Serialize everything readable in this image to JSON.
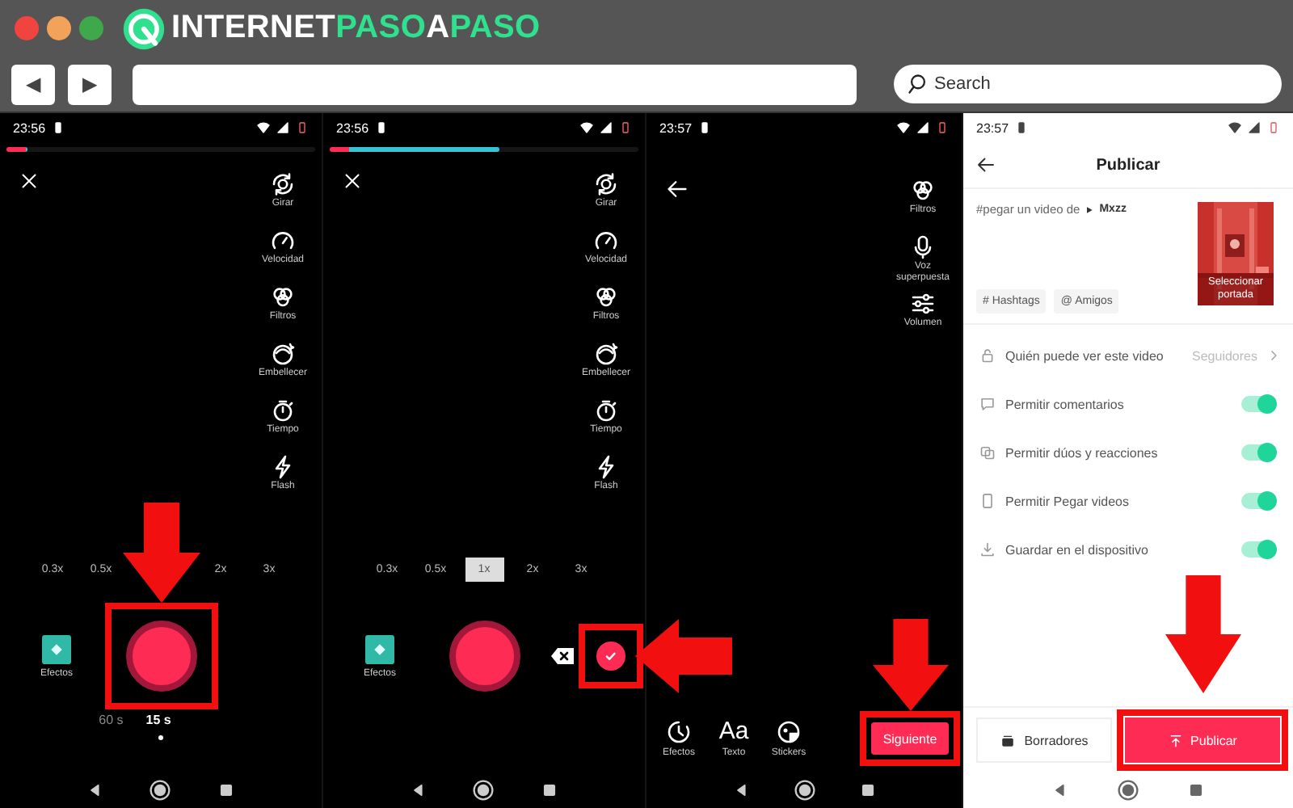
{
  "browser": {
    "window_controls": [
      {
        "color": "#f0453f"
      },
      {
        "color": "#f3a25a"
      },
      {
        "color": "#3ea84a"
      }
    ],
    "logo": [
      {
        "text": "INTERNET",
        "color": "#ffffff"
      },
      {
        "text": "PASO",
        "color": "#2fe08f"
      },
      {
        "text": "A",
        "color": "#ffffff"
      },
      {
        "text": "PASO",
        "color": "#2fe08f"
      }
    ],
    "back_button": "◀",
    "forward_button": "▶",
    "search_field": {
      "placeholder": "Search"
    }
  },
  "screens": [
    {
      "kind": "camera",
      "time": "23:56",
      "progress": {
        "level": 0.07
      },
      "tools": [
        "Girar",
        "Velocidad",
        "Filtros",
        "Embellecer",
        "Tiempo",
        "Flash"
      ],
      "zoom_options": [
        {
          "label": "0.3x",
          "selected": false
        },
        {
          "label": "0.5x",
          "selected": false
        },
        {
          "label": "2x",
          "selected": false
        },
        {
          "label": "3x",
          "selected": false
        }
      ],
      "effects_label": "Efectos",
      "record_button": {
        "highlight": {
          "kind": "down"
        }
      },
      "durations": [
        {
          "label": "60 s",
          "selected": false
        },
        {
          "label": "15 s",
          "selected": true
        }
      ]
    },
    {
      "kind": "camera",
      "time": "23:56",
      "progress": {
        "level": 0.55
      },
      "tools": [
        "Girar",
        "Velocidad",
        "Filtros",
        "Embellecer",
        "Tiempo",
        "Flash"
      ],
      "zoom_options": [
        {
          "label": "0.3x",
          "selected": false
        },
        {
          "label": "0.5x",
          "selected": false
        },
        {
          "label": "1x",
          "selected": true
        },
        {
          "label": "2x",
          "selected": false
        },
        {
          "label": "3x",
          "selected": false
        }
      ],
      "effects_label": "Efectos",
      "confirm_button": {
        "highlight": {
          "kind": "left"
        }
      }
    },
    {
      "kind": "edit",
      "time": "23:57",
      "tools": [
        "Filtros",
        "Voz superpuesta",
        "Volumen"
      ],
      "bottom_tools": [
        {
          "kind": "icon",
          "label": "Efectos"
        },
        {
          "kind": "glyph",
          "glyph": "Aa",
          "label": "Texto"
        },
        {
          "kind": "icon",
          "label": "Stickers"
        }
      ],
      "next_button": {
        "label": "Siguiente",
        "highlight": {
          "kind": "down"
        }
      }
    },
    {
      "kind": "publish",
      "time": "23:57",
      "title": "Publicar",
      "caption": "#pegar un video de",
      "caption_tag": "Mxzz",
      "cover_label": "Seleccionar portada",
      "chips": [
        "# Hashtags",
        "@ Amigos"
      ],
      "settings": [
        {
          "kind": "link",
          "label": "Quién puede ver este video",
          "value": "Seguidores"
        },
        {
          "kind": "toggle",
          "label": "Permitir comentarios",
          "on": true
        },
        {
          "kind": "toggle",
          "label": "Permitir dúos y reacciones",
          "on": true
        },
        {
          "kind": "toggle",
          "label": "Permitir Pegar videos",
          "on": true
        },
        {
          "kind": "toggle",
          "label": "Guardar en el dispositivo",
          "on": true
        }
      ],
      "drafts_button": {
        "label": "Borradores"
      },
      "publish_button": {
        "label": "Publicar",
        "highlight": {
          "kind": "down"
        }
      }
    }
  ]
}
